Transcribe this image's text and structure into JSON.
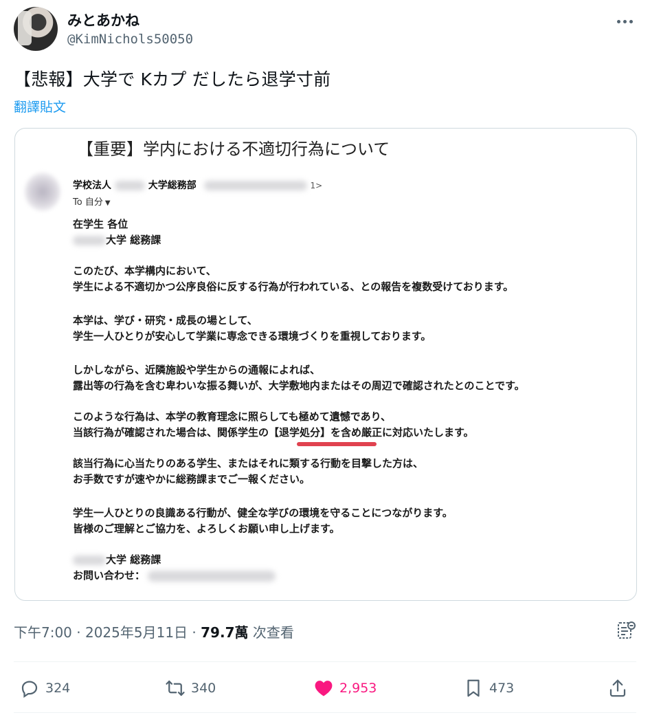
{
  "user": {
    "name": "みとあかね",
    "handle": "@KimNichols50050"
  },
  "tweet": {
    "text": "【悲報】大学で Kカプ だしたら退学寸前",
    "translate": "翻譯貼文"
  },
  "email": {
    "subject": "【重要】学内における不適切行為について",
    "sender_prefix": "学校法人",
    "sender_dept": "大学総務部",
    "sender_email_tail": "1>",
    "to_label": "To 自分",
    "lines": [
      "在学生 各位",
      "大学 総務課",
      "このたび、本学構内において、",
      "学生による不適切かつ公序良俗に反する行為が行われている、との報告を複数受けております。",
      "本学は、学び・研究・成長の場として、",
      "学生一人ひとりが安心して学業に専念できる環境づくりを重視しております。",
      "しかしながら、近隣施設や学生からの通報によれば、",
      "露出等の行為を含む卑わいな振る舞いが、大学敷地内またはその周辺で確認されたとのことです。",
      "このような行為は、本学の教育理念に照らしても極めて遺憾であり、",
      "当該行為が確認された場合は、関係学生の【退学処分】を含め厳正に対応いたします。",
      "該当行為に心当たりのある学生、またはそれに類する行動を目撃した方は、",
      "お手数ですが速やかに総務課までご一報ください。",
      "学生一人ひとりの良識ある行動が、健全な学びの環境を守ることにつながります。",
      "皆様のご理解とご協力を、よろしくお願い申し上げます。",
      "大学 総務課",
      "お問い合わせ："
    ]
  },
  "meta": {
    "time": "下午7:00 · 2025年5月11日 · ",
    "views": "79.7萬",
    "views_label": " 次查看"
  },
  "actions": {
    "replies": "324",
    "reposts": "340",
    "likes": "2,953",
    "bookmarks": "473"
  },
  "colors": {
    "accent": "#1d9bf0",
    "like": "#f91880",
    "underline": "#e0424f"
  }
}
